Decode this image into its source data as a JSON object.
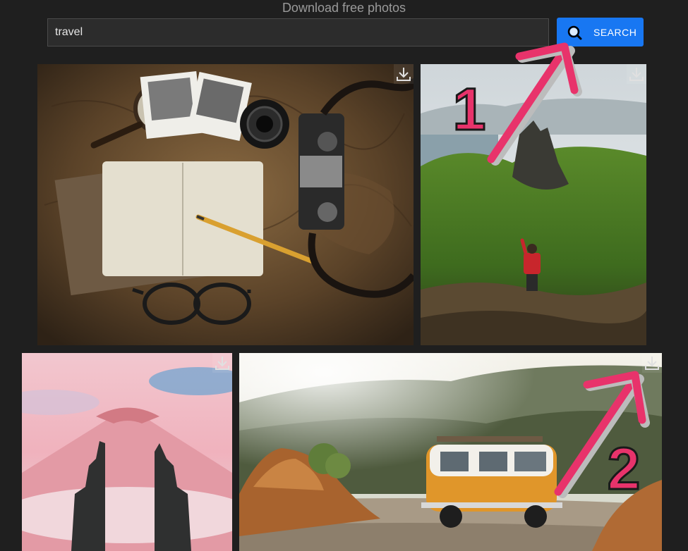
{
  "header": {
    "title": "Download free photos"
  },
  "search": {
    "value": "travel",
    "button_label": "SEARCH"
  },
  "colors": {
    "accent": "#1877f2",
    "annotation": "#e8336b",
    "background": "#1f1f1f"
  },
  "annotations": [
    {
      "label": "1"
    },
    {
      "label": "2"
    }
  ],
  "photos": [
    {
      "name": "travel-flatlay",
      "icon": "download-icon"
    },
    {
      "name": "hiker-mountains",
      "icon": "download-icon"
    },
    {
      "name": "temple-gate",
      "icon": "download-icon"
    },
    {
      "name": "camper-van",
      "icon": "download-icon"
    }
  ]
}
